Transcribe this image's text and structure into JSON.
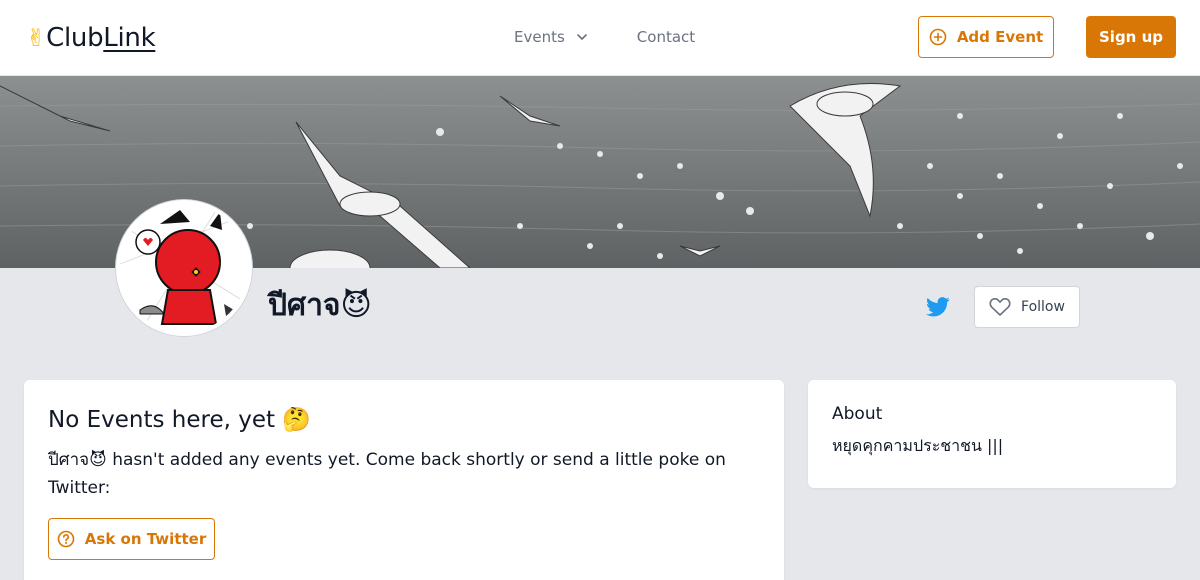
{
  "header": {
    "logo": {
      "icon": "victory-hand-icon",
      "text_club": "Club",
      "text_link": "Link"
    },
    "nav": {
      "events_label": "Events",
      "contact_label": "Contact"
    },
    "add_event_label": "Add Event",
    "sign_up_label": "Sign up"
  },
  "profile": {
    "name": "ปีศาจ😈",
    "follow_label": "Follow"
  },
  "events": {
    "title": "No Events here, yet 🤔",
    "message": "ปีศาจ😈 hasn't added any events yet. Come back shortly or send a little poke on Twitter:",
    "ask_label": "Ask on Twitter"
  },
  "about": {
    "title": "About",
    "text": "หยุดคุกคามประชาชน |||"
  },
  "colors": {
    "accent": "#d97706",
    "twitter": "#1d9bf0",
    "page_bg": "#e5e7eb"
  }
}
